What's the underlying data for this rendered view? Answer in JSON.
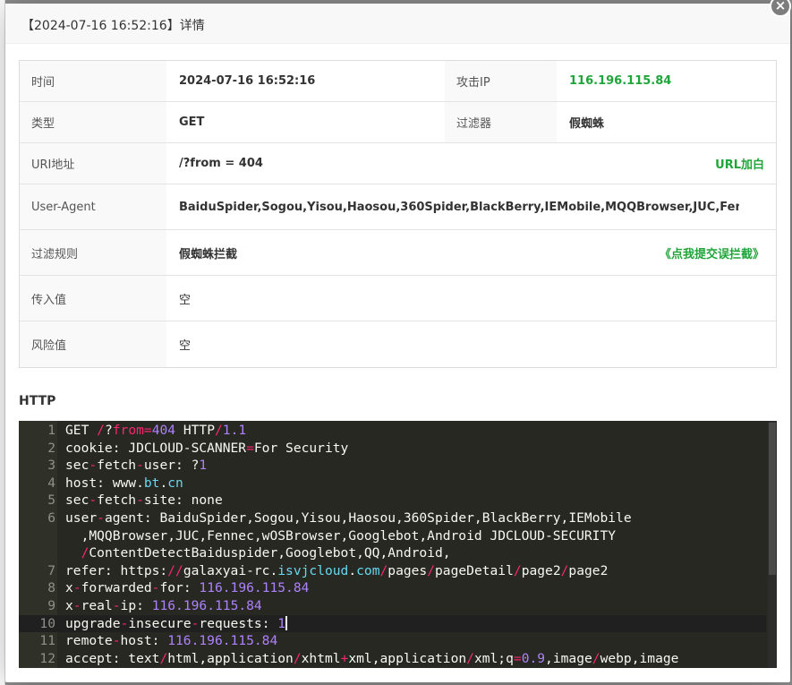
{
  "dialog": {
    "title": "【2024-07-16 16:52:16】详情",
    "close_label": "×"
  },
  "details": {
    "time_label": "时间",
    "time_value": "2024-07-16 16:52:16",
    "ip_label": "攻击IP",
    "ip_value": "116.196.115.84",
    "type_label": "类型",
    "type_value": "GET",
    "filter_label": "过滤器",
    "filter_value": "假蜘蛛",
    "uri_label": "URI地址",
    "uri_value": "/?from = 404",
    "uri_action": "URL加白",
    "ua_label": "User-Agent",
    "ua_value": "BaiduSpider,Sogou,Yisou,Haosou,360Spider,BlackBerry,IEMobile,MQQBrowser,JUC,Fennec,w...",
    "rule_label": "过滤规则",
    "rule_value": "假蜘蛛拦截",
    "rule_action": "《点我提交误拦截》",
    "input_label": "传入值",
    "input_value": "空",
    "risk_label": "风险值",
    "risk_value": "空"
  },
  "http": {
    "section_title": "HTTP",
    "lines": [
      {
        "n": "1",
        "segs": [
          [
            "t",
            "GET "
          ],
          [
            "o",
            "/"
          ],
          [
            "t",
            "?"
          ],
          [
            "o",
            "from"
          ],
          [
            "o",
            "="
          ],
          [
            "n",
            "404"
          ],
          [
            "t",
            " HTTP"
          ],
          [
            "o",
            "/"
          ],
          [
            "n",
            "1.1"
          ]
        ]
      },
      {
        "n": "2",
        "segs": [
          [
            "t",
            "cookie: JDCLOUD-SCANNER"
          ],
          [
            "o",
            "="
          ],
          [
            "t",
            "For Security"
          ]
        ]
      },
      {
        "n": "3",
        "segs": [
          [
            "t",
            "sec"
          ],
          [
            "o",
            "-"
          ],
          [
            "t",
            "fetch"
          ],
          [
            "o",
            "-"
          ],
          [
            "t",
            "user: ?"
          ],
          [
            "n",
            "1"
          ]
        ]
      },
      {
        "n": "4",
        "segs": [
          [
            "t",
            "host: www."
          ],
          [
            "u",
            "bt"
          ],
          [
            "t",
            "."
          ],
          [
            "u",
            "cn"
          ]
        ]
      },
      {
        "n": "5",
        "segs": [
          [
            "t",
            "sec"
          ],
          [
            "o",
            "-"
          ],
          [
            "t",
            "fetch"
          ],
          [
            "o",
            "-"
          ],
          [
            "t",
            "site: none"
          ]
        ]
      },
      {
        "n": "6",
        "segs": [
          [
            "t",
            "user"
          ],
          [
            "o",
            "-"
          ],
          [
            "t",
            "agent: BaiduSpider,Sogou,Yisou,Haosou,360Spider,BlackBerry,IEMobile"
          ]
        ]
      },
      {
        "n": "",
        "segs": [
          [
            "t",
            "  ,MQQBrowser,JUC,Fennec,wOSBrowser,Googlebot,Android JDCLOUD-SECURITY"
          ]
        ]
      },
      {
        "n": "",
        "segs": [
          [
            "t",
            "  "
          ],
          [
            "o",
            "/"
          ],
          [
            "t",
            "ContentDetectBaiduspider,Googlebot,QQ,Android,"
          ]
        ]
      },
      {
        "n": "7",
        "segs": [
          [
            "t",
            "refer: https:"
          ],
          [
            "o",
            "//"
          ],
          [
            "t",
            "galaxyai-rc."
          ],
          [
            "u",
            "isvjcloud"
          ],
          [
            "t",
            "."
          ],
          [
            "u",
            "com"
          ],
          [
            "o",
            "/"
          ],
          [
            "t",
            "pages"
          ],
          [
            "o",
            "/"
          ],
          [
            "t",
            "pageDetail"
          ],
          [
            "o",
            "/"
          ],
          [
            "t",
            "page2"
          ],
          [
            "o",
            "/"
          ],
          [
            "t",
            "page2"
          ]
        ]
      },
      {
        "n": "8",
        "segs": [
          [
            "t",
            "x"
          ],
          [
            "o",
            "-"
          ],
          [
            "t",
            "forwarded"
          ],
          [
            "o",
            "-"
          ],
          [
            "t",
            "for: "
          ],
          [
            "n",
            "116.196.115.84"
          ]
        ]
      },
      {
        "n": "9",
        "segs": [
          [
            "t",
            "x"
          ],
          [
            "o",
            "-"
          ],
          [
            "t",
            "real"
          ],
          [
            "o",
            "-"
          ],
          [
            "t",
            "ip: "
          ],
          [
            "n",
            "116.196.115.84"
          ]
        ]
      },
      {
        "n": "10",
        "segs": [
          [
            "t",
            "upgrade"
          ],
          [
            "o",
            "-"
          ],
          [
            "t",
            "insecure"
          ],
          [
            "o",
            "-"
          ],
          [
            "t",
            "requests: "
          ],
          [
            "n",
            "1"
          ]
        ]
      },
      {
        "n": "11",
        "segs": [
          [
            "t",
            "remote"
          ],
          [
            "o",
            "-"
          ],
          [
            "t",
            "host: "
          ],
          [
            "n",
            "116.196.115.84"
          ]
        ]
      },
      {
        "n": "12",
        "segs": [
          [
            "t",
            "accept: text"
          ],
          [
            "o",
            "/"
          ],
          [
            "t",
            "html,application"
          ],
          [
            "o",
            "/"
          ],
          [
            "t",
            "xhtml"
          ],
          [
            "o",
            "+"
          ],
          [
            "t",
            "xml,application"
          ],
          [
            "o",
            "/"
          ],
          [
            "t",
            "xml;q"
          ],
          [
            "o",
            "="
          ],
          [
            "n",
            "0.9"
          ],
          [
            "t",
            ",image"
          ],
          [
            "o",
            "/"
          ],
          [
            "t",
            "webp,image"
          ]
        ]
      }
    ]
  }
}
